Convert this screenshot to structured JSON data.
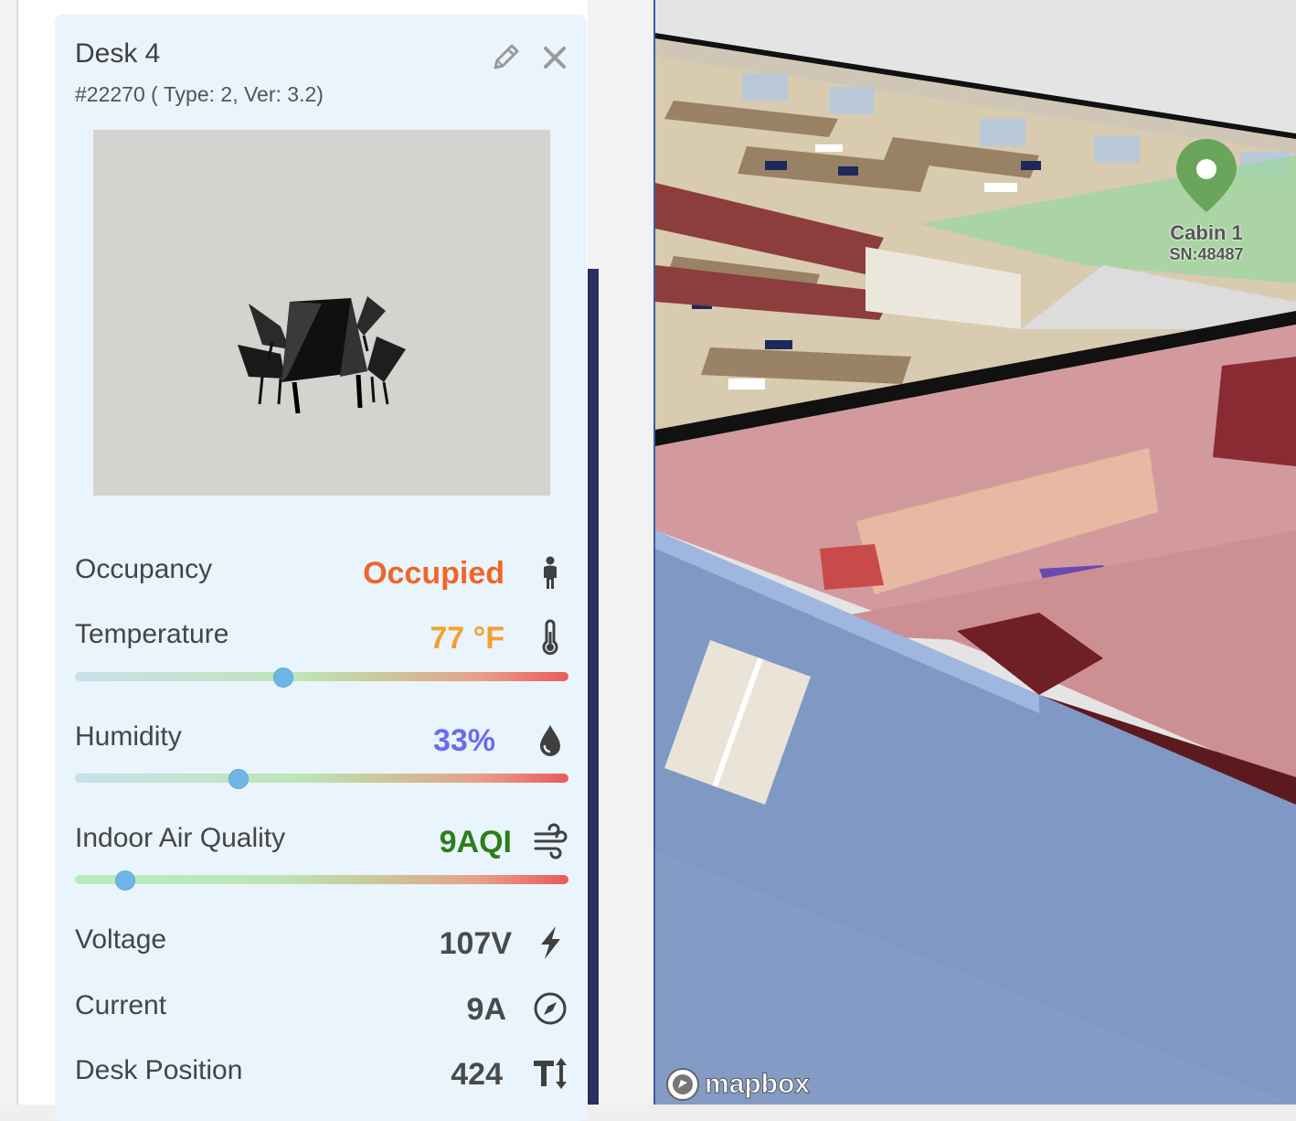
{
  "desk": {
    "title": "Desk 4",
    "subtitle": "#22270 ( Type: 2, Ver: 3.2)",
    "icons": {
      "edit": "pencil-icon",
      "close": "close-icon"
    }
  },
  "metrics": {
    "occupancy": {
      "label": "Occupancy",
      "value": "Occupied",
      "color": "#f06529",
      "icon": "person-icon"
    },
    "temperature": {
      "label": "Temperature",
      "value": "77 °F",
      "color": "#f5a02e",
      "icon": "thermometer-icon",
      "level": 0.42
    },
    "humidity": {
      "label": "Humidity",
      "value": "33%",
      "color": "#6b6bef",
      "icon": "droplet-icon",
      "level": 0.33
    },
    "aqi": {
      "label": "Indoor Air Quality",
      "value": "9AQI",
      "color": "#2e7d19",
      "icon": "wind-icon",
      "level": 0.1
    },
    "voltage": {
      "label": "Voltage",
      "value": "107V",
      "color": "#4a4a4a",
      "icon": "lightning-icon"
    },
    "current": {
      "label": "Current",
      "value": "9A",
      "color": "#4a4a4a",
      "icon": "compass-icon"
    },
    "desk_position": {
      "label": "Desk Position",
      "value": "424",
      "color": "#4a4a4a",
      "icon": "text-height-icon"
    }
  },
  "map": {
    "marker": {
      "name": "Cabin 1",
      "serial": "SN:48487"
    },
    "attribution": "mapbox"
  }
}
